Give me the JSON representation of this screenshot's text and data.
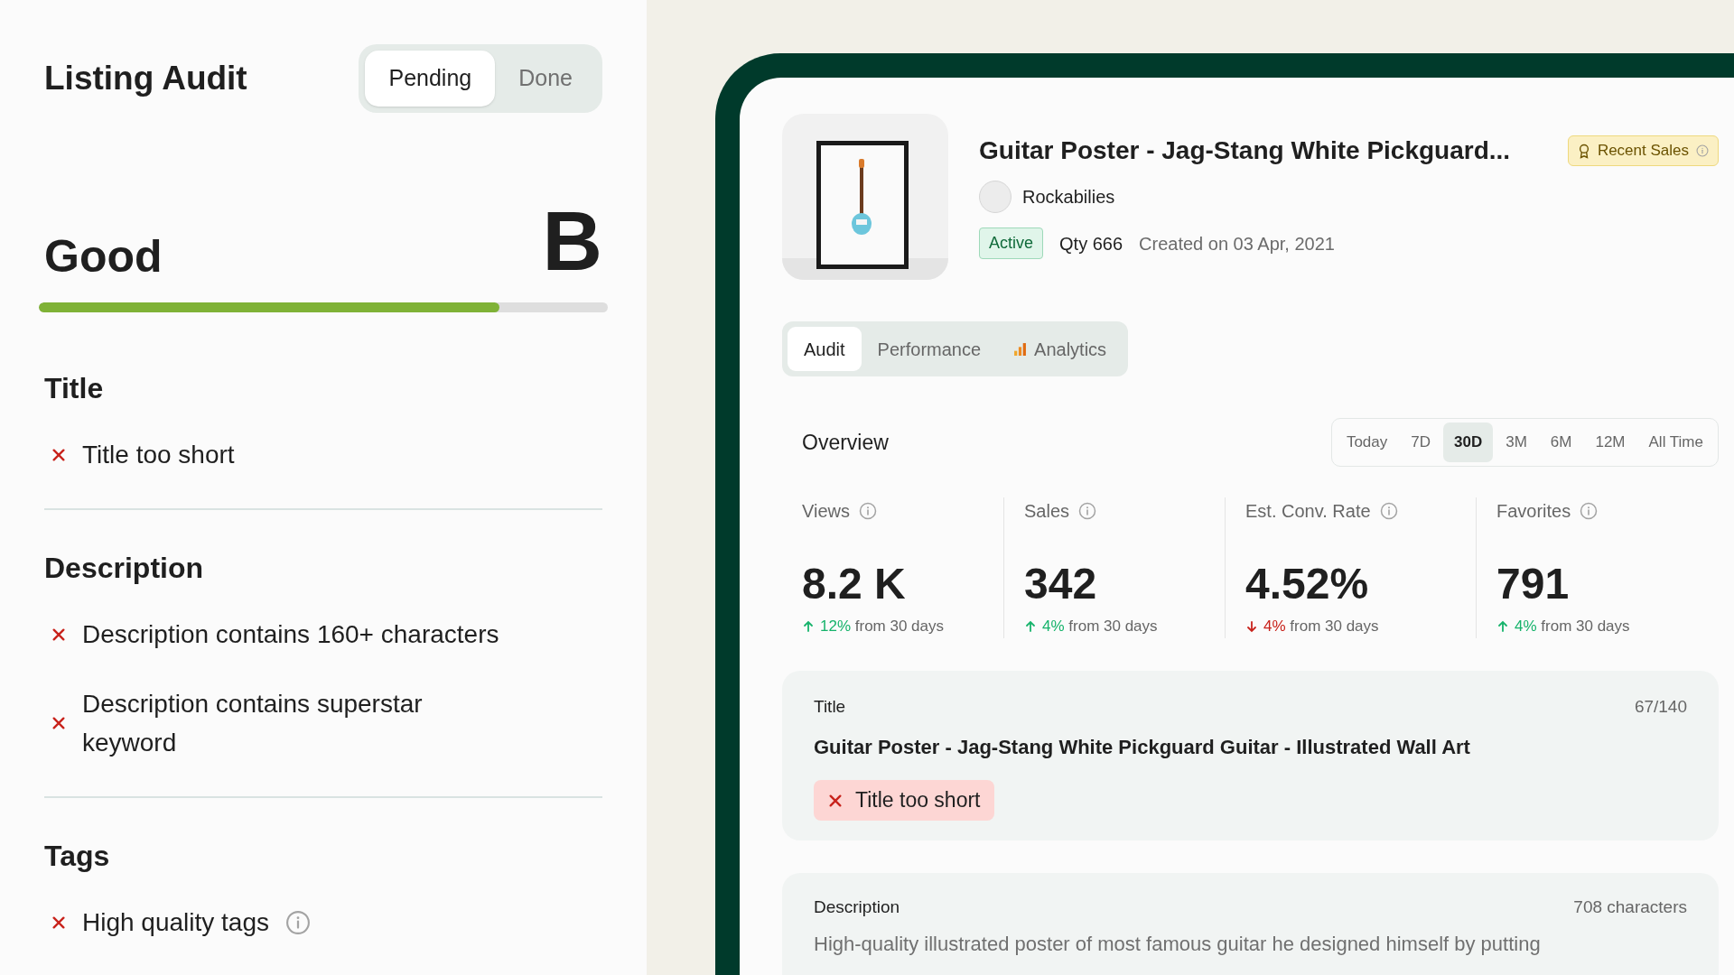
{
  "audit": {
    "title": "Listing Audit",
    "filter_tabs": [
      {
        "label": "Pending",
        "selected": true
      },
      {
        "label": "Done",
        "selected": false
      }
    ],
    "rating": "Good",
    "grade": "B",
    "level": 0.81,
    "sections": [
      {
        "heading": "Title",
        "checks": [
          {
            "text": "Title too short",
            "passed": false,
            "info": false
          }
        ]
      },
      {
        "heading": "Description",
        "checks": [
          {
            "text": "Description contains 160+ characters",
            "passed": false,
            "info": false
          },
          {
            "text": "Description contains superstar keyword",
            "passed": false,
            "info": false
          }
        ]
      },
      {
        "heading": "Tags",
        "checks": [
          {
            "text": "High quality tags",
            "passed": false,
            "info": true
          }
        ]
      }
    ]
  },
  "listing": {
    "title": "Guitar Poster - Jag-Stang White Pickguard...",
    "badge": "Recent Sales",
    "shop": "Rockabilies",
    "status": "Active",
    "quantity": "Qty 666",
    "created": "Created on 03 Apr, 2021",
    "tabs": [
      {
        "label": "Audit",
        "selected": true,
        "icon": false
      },
      {
        "label": "Performance",
        "selected": false,
        "icon": false
      },
      {
        "label": "Analytics",
        "selected": false,
        "icon": true
      }
    ],
    "overview": {
      "title": "Overview",
      "ranges": [
        {
          "label": "Today",
          "selected": false
        },
        {
          "label": "7D",
          "selected": false
        },
        {
          "label": "30D",
          "selected": true
        },
        {
          "label": "3M",
          "selected": false
        },
        {
          "label": "6M",
          "selected": false
        },
        {
          "label": "12M",
          "selected": false
        },
        {
          "label": "All Time",
          "selected": false
        }
      ],
      "stats": [
        {
          "label": "Views",
          "value": "8.2 K",
          "change": "12%",
          "kind": "up",
          "suffix": "from 30 days"
        },
        {
          "label": "Sales",
          "value": "342",
          "change": "4%",
          "kind": "up",
          "suffix": "from 30 days"
        },
        {
          "label": "Est. Conv. Rate",
          "value": "4.52%",
          "change": "4%",
          "kind": "down",
          "suffix": "from 30 days"
        },
        {
          "label": "Favorites",
          "value": "791",
          "change": "4%",
          "kind": "up",
          "suffix": "from 30 days"
        }
      ]
    },
    "title_card": {
      "label": "Title",
      "count": "67/140",
      "text": "Guitar Poster - Jag-Stang White Pickguard Guitar - Illustrated Wall Art",
      "issue": "Title too short"
    },
    "description_card": {
      "label": "Description",
      "count": "708 characters",
      "lines": [
        "High-quality illustrated poster of most famous guitar he designed himself by putting"
      ]
    }
  }
}
